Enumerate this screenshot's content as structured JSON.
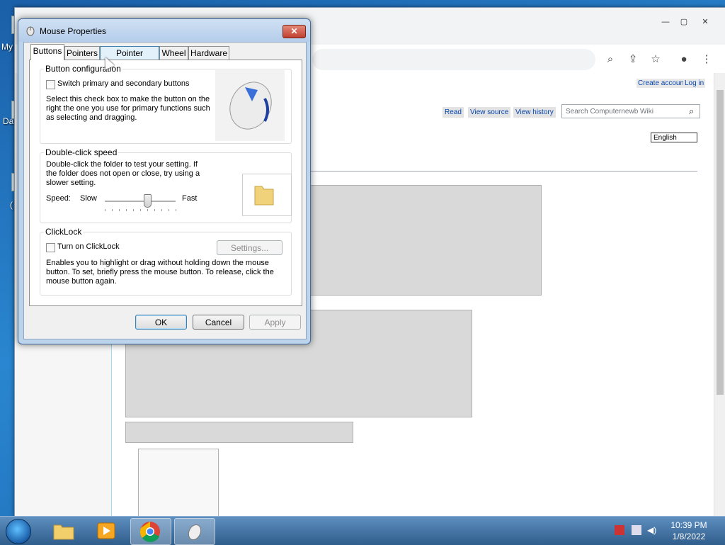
{
  "desktop": {
    "labels": [
      "My",
      "Dat",
      "("
    ]
  },
  "browser": {
    "window_controls": {
      "minimize": "—",
      "maximize": "▢",
      "close": "✕"
    },
    "toolbar_icons": [
      "zoom-icon",
      "share-icon",
      "bookmark-star-icon",
      "profile-icon",
      "menu-icon"
    ],
    "wiki": {
      "create_account": "Create account",
      "log_in": "Log in",
      "tabs": [
        "Read",
        "View source",
        "View history"
      ],
      "search_placeholder": "Search Computernewb Wiki",
      "language": "English"
    }
  },
  "dialog": {
    "title": "Mouse Properties",
    "close": "✕",
    "tabs": [
      "Buttons",
      "Pointers",
      "Pointer Options",
      "Wheel",
      "Hardware"
    ],
    "button_config": {
      "heading": "Button configuration",
      "checkbox_label": "Switch primary and secondary buttons",
      "description": "Select this check box to make the button on the right the one you use for primary functions such as selecting and dragging."
    },
    "double_click": {
      "heading": "Double-click speed",
      "description": "Double-click the folder to test your setting. If the folder does not open or close, try using a slower setting.",
      "speed_label": "Speed:",
      "slow": "Slow",
      "fast": "Fast",
      "slider_value": 0.6
    },
    "clicklock": {
      "heading": "ClickLock",
      "checkbox_label": "Turn on ClickLock",
      "settings_button": "Settings...",
      "description": "Enables you to highlight or drag without holding down the mouse button. To set, briefly press the mouse button. To release, click the mouse button again."
    },
    "buttons": {
      "ok": "OK",
      "cancel": "Cancel",
      "apply": "Apply"
    }
  },
  "taskbar": {
    "clock_time": "10:39 PM",
    "clock_date": "1/8/2022"
  }
}
